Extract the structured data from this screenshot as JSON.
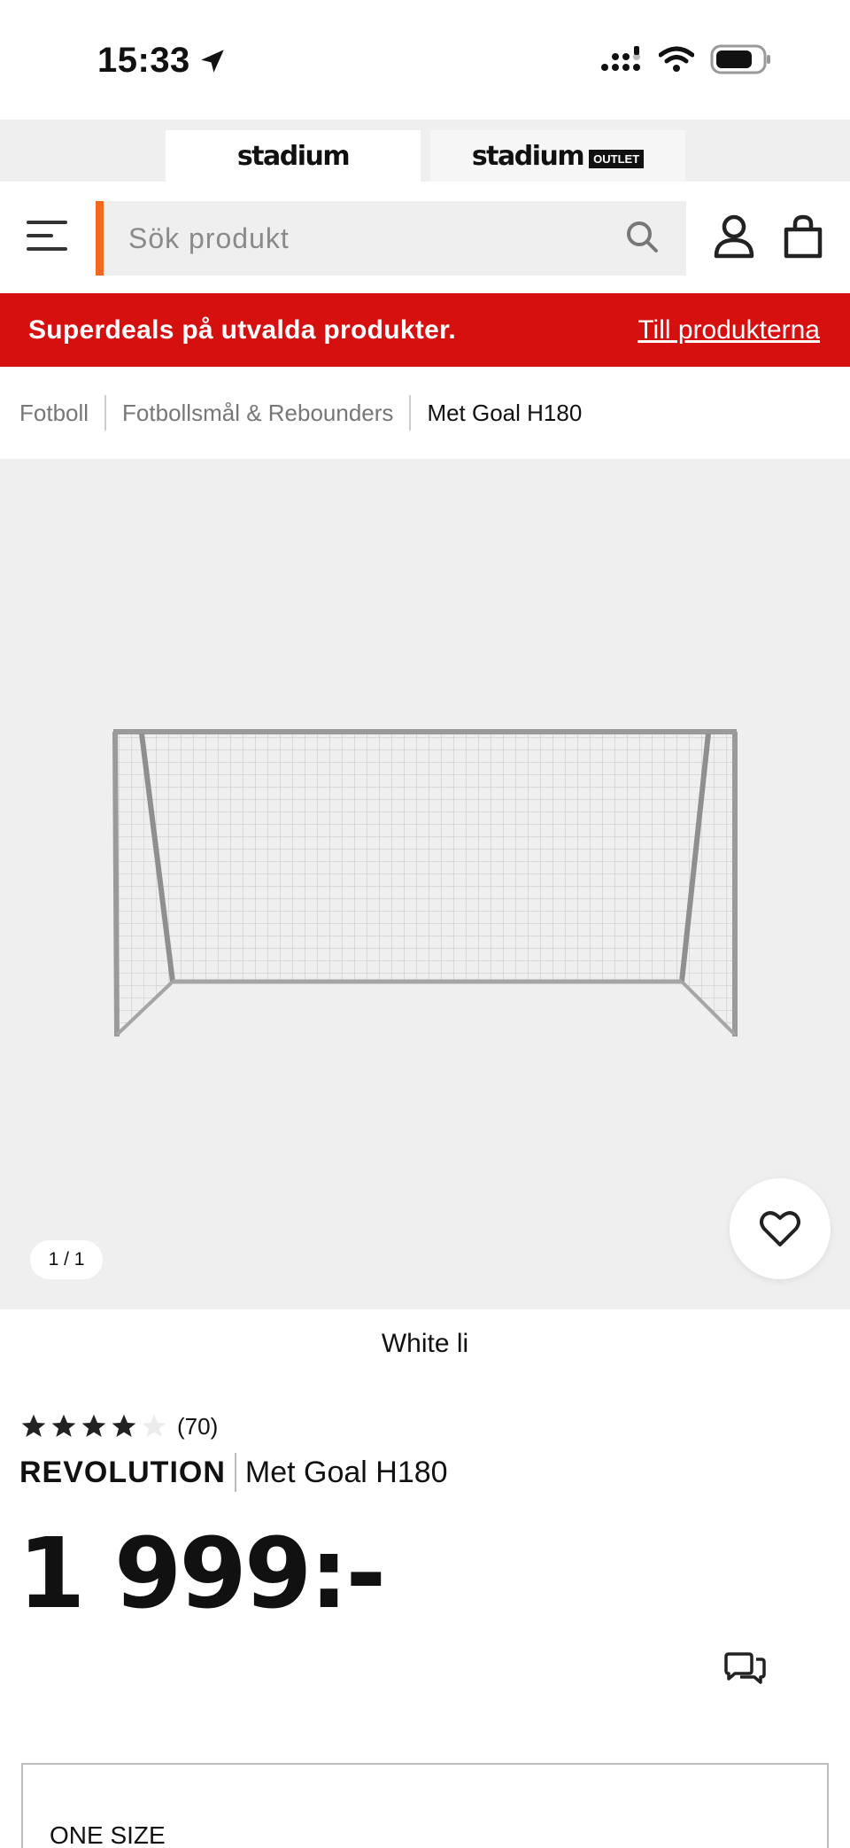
{
  "status_bar": {
    "time": "15:33"
  },
  "store_switch": {
    "tabs": [
      {
        "label": "stadium",
        "active": true
      },
      {
        "label": "stadium",
        "badge": "OUTLET",
        "active": false
      }
    ]
  },
  "header": {
    "search_placeholder": "Sök produkt",
    "accent_color": "#f26a1b"
  },
  "promo": {
    "text": "Superdeals på utvalda produkter.",
    "link": "Till produkterna",
    "background": "#d60f0f"
  },
  "breadcrumb": {
    "items": [
      "Fotboll",
      "Fotbollsmål & Rebounders",
      "Met Goal H180"
    ]
  },
  "gallery": {
    "counter": "1 / 1"
  },
  "product": {
    "variant": "White li",
    "rating_value": 4,
    "rating_max": 5,
    "rating_count": "(70)",
    "brand": "REVOLUTION",
    "name": "Met Goal H180",
    "price": "1 999:-"
  },
  "size": {
    "label": "ONE SIZE"
  }
}
